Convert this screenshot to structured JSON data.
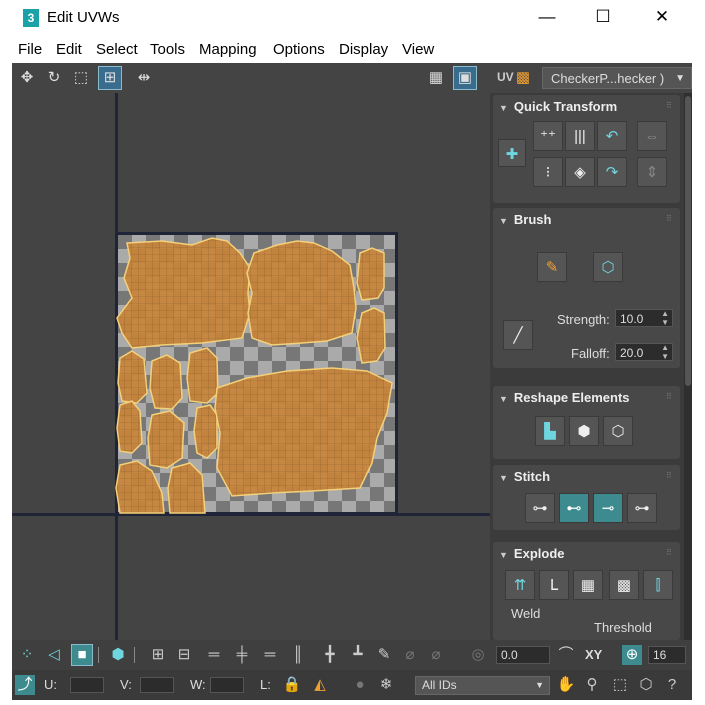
{
  "window": {
    "app_icon": "3",
    "title": "Edit UVWs",
    "controls": {
      "minimize": "—",
      "maximize": "☐",
      "close": "✕"
    }
  },
  "menu": [
    "File",
    "Edit",
    "Select",
    "Tools",
    "Mapping",
    "Options",
    "Display",
    "View"
  ],
  "toolbar": {
    "uv_label": "UV",
    "texture_dropdown": "CheckerP...hecker )",
    "icons": [
      "move-icon",
      "rotate-icon",
      "scale-icon",
      "freeform-icon",
      "mirror-icon",
      "checker-grid-icon",
      "show-map-icon",
      "uv-label",
      "texture-options-icon"
    ]
  },
  "panel": {
    "quick_transform": {
      "title": "Quick Transform"
    },
    "brush": {
      "title": "Brush",
      "strength_label": "Strength:",
      "strength_value": "10.0",
      "falloff_label": "Falloff:",
      "falloff_value": "20.0"
    },
    "reshape": {
      "title": "Reshape Elements"
    },
    "stitch": {
      "title": "Stitch"
    },
    "explode": {
      "title": "Explode",
      "weld_label": "Weld",
      "threshold_label": "Threshold"
    }
  },
  "bottom": {
    "spinner_value": "0.0",
    "xy_label": "XY",
    "grid_value": "16",
    "u_label": "U:",
    "v_label": "V:",
    "w_label": "W:",
    "l_label": "L:",
    "ids_dropdown": "All IDs"
  },
  "colors": {
    "accent": "#3d8b8f",
    "uv_fill": "#c8843a",
    "uv_border": "#f3d07a",
    "viewport_bg": "#444444"
  }
}
